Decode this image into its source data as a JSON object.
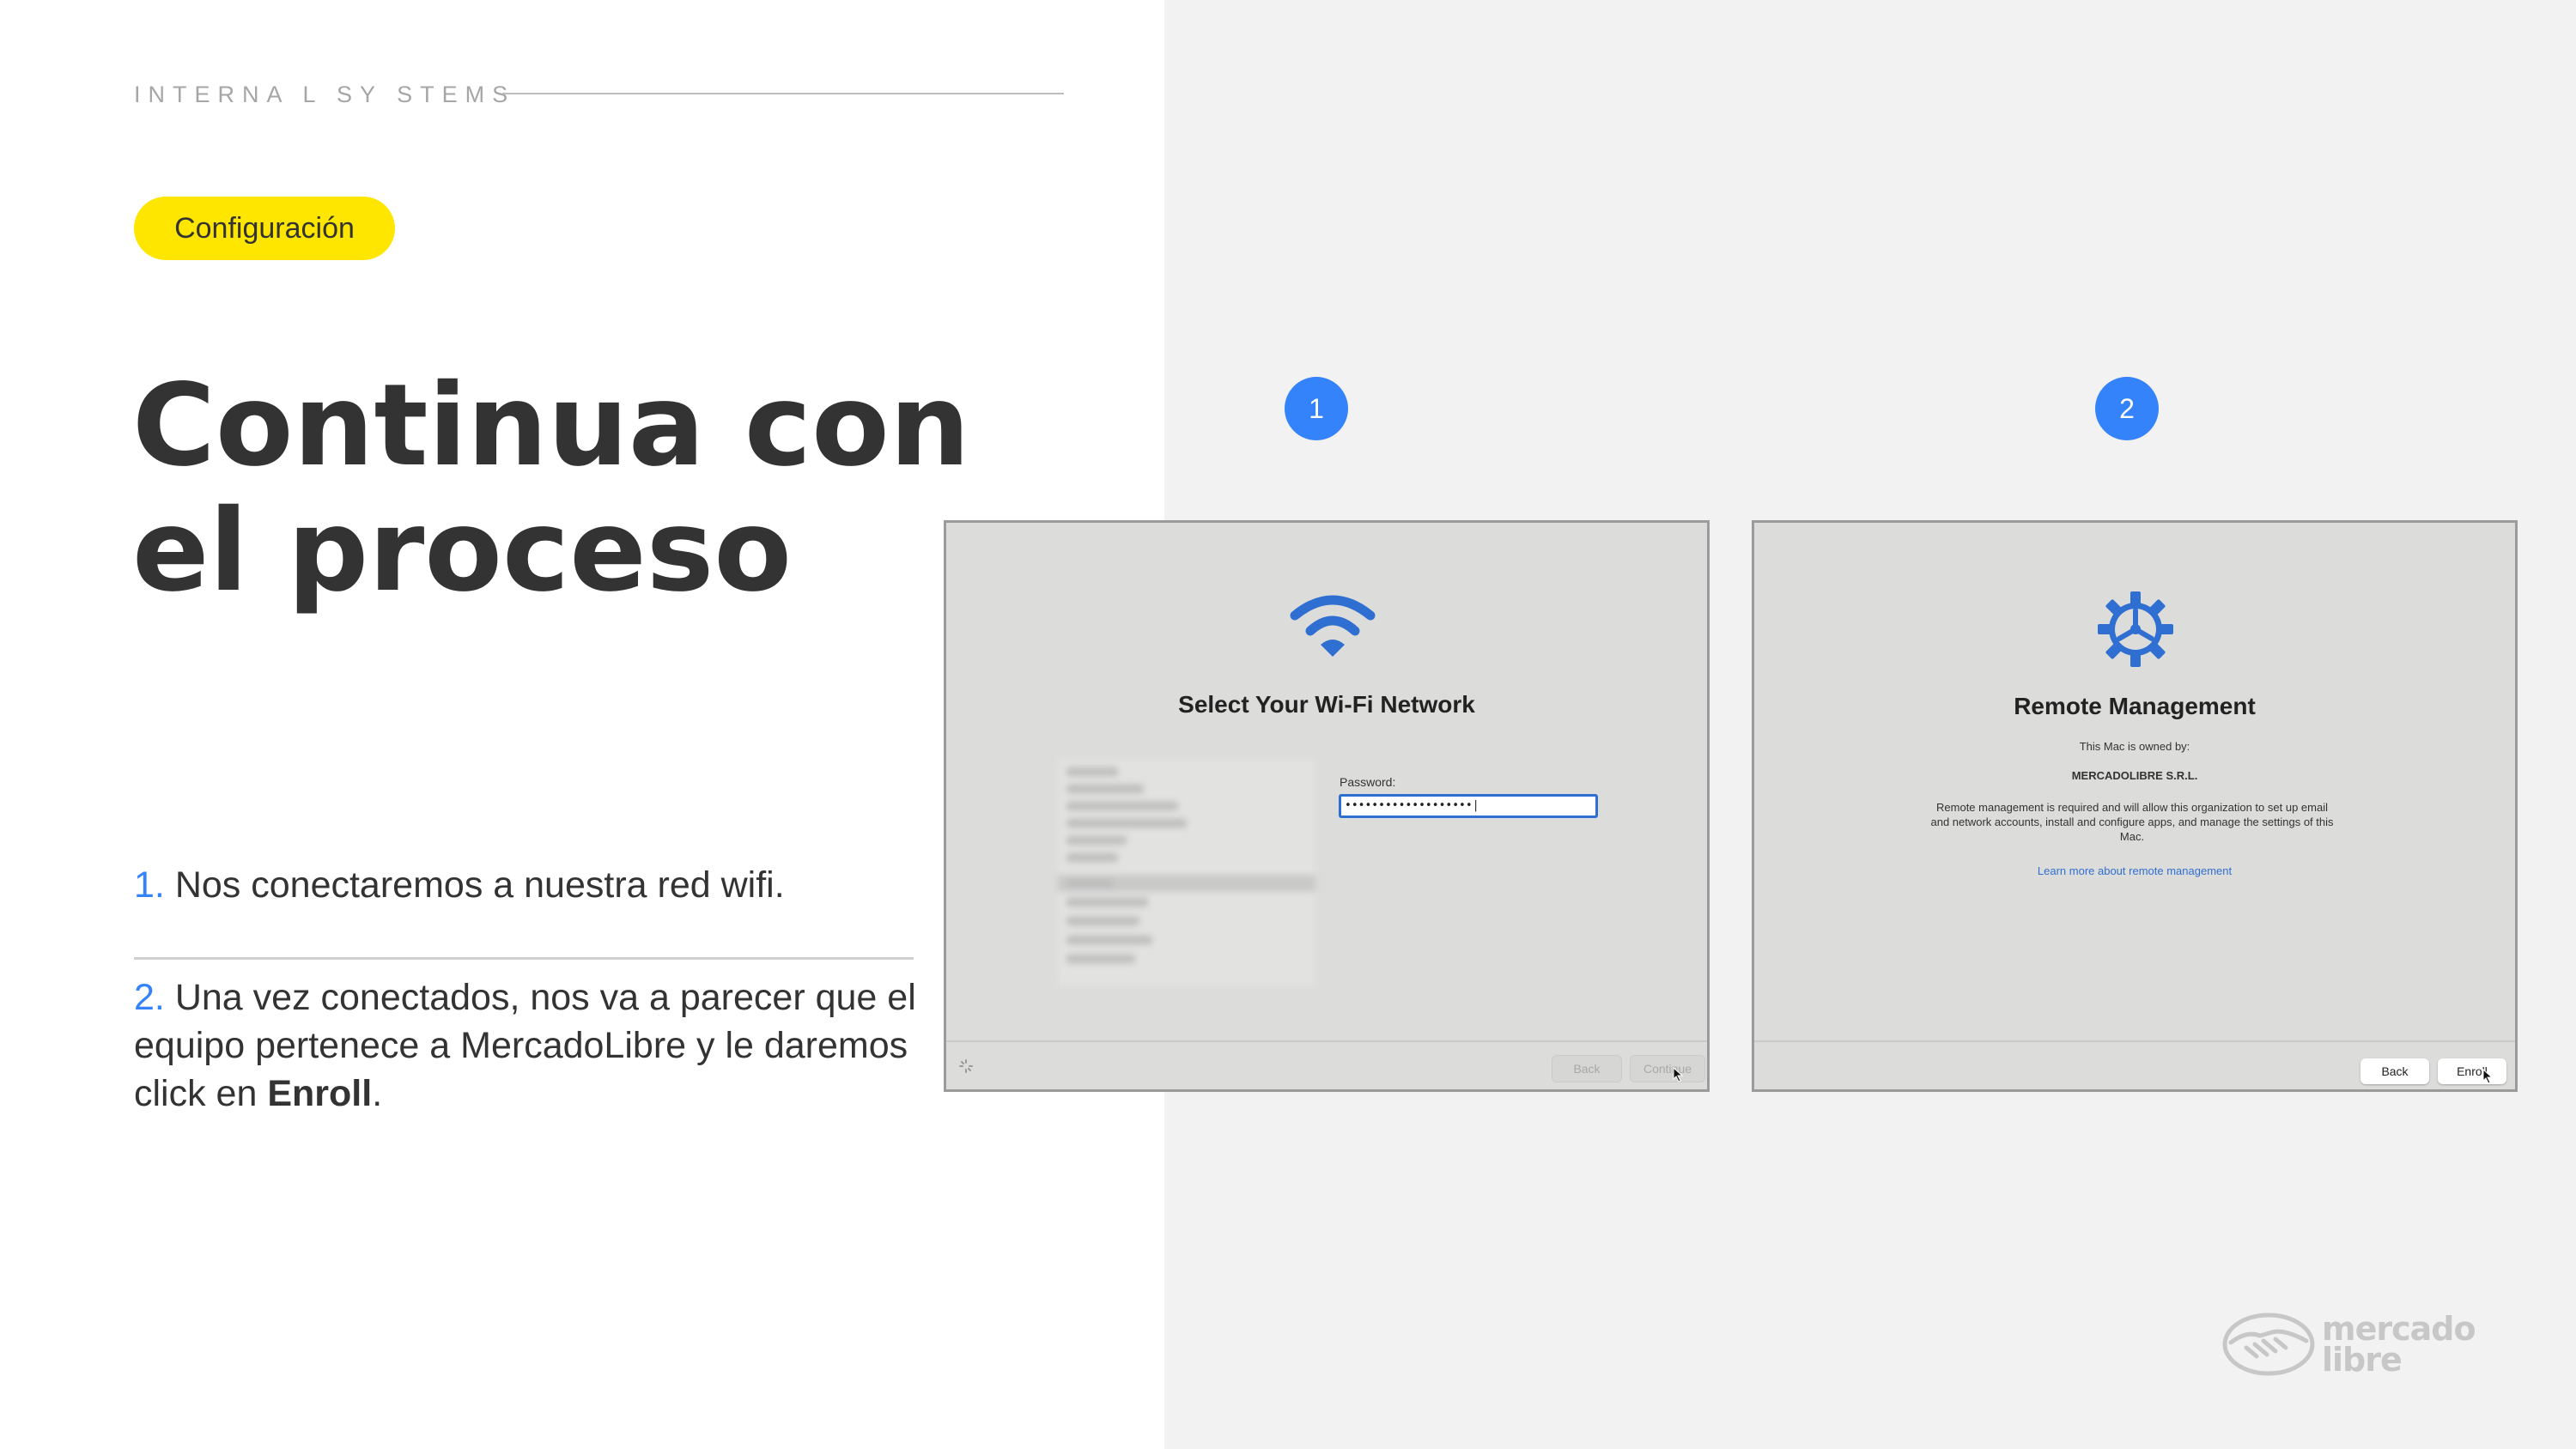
{
  "header": {
    "label": "INTERNA L SY STEMS"
  },
  "tag": {
    "label": "Configuración"
  },
  "title": {
    "line1": "Continua con",
    "line2": "el proceso"
  },
  "steps": [
    {
      "number": "1.",
      "text": "Nos conectaremos a nuestra red wifi."
    },
    {
      "number": "2.",
      "text_before": "Una vez conectados, nos va a parecer que el equipo pertenece a MercadoLibre y le daremos  click en ",
      "bold": "Enroll",
      "text_after": "."
    }
  ],
  "badges": [
    "1",
    "2"
  ],
  "screenshot1": {
    "title": "Select Your Wi-Fi Network",
    "password_label": "Password:",
    "password_value": "•••••••••••••••••••|",
    "back_button": "Back",
    "continue_button": "Continue",
    "icon": "wifi-icon",
    "accent_color": "#2f6fd1"
  },
  "screenshot2": {
    "title": "Remote Management",
    "owned_by_label": "This Mac is owned by:",
    "owner": "MERCADOLIBRE S.R.L.",
    "description": "Remote management is required and will allow this organization to set up email and network accounts, install and configure apps, and manage the settings of this Mac.",
    "link": "Learn more about remote management",
    "back_button": "Back",
    "enroll_button": "Enroll",
    "icon": "gear-icon"
  },
  "logo": {
    "line1": "mercado",
    "line2": "libre",
    "icon": "handshake-icon"
  },
  "colors": {
    "accent_yellow": "#ffe600",
    "accent_blue": "#3483fa",
    "text_dark": "#333333",
    "panel_gray": "#f2f2f2"
  }
}
